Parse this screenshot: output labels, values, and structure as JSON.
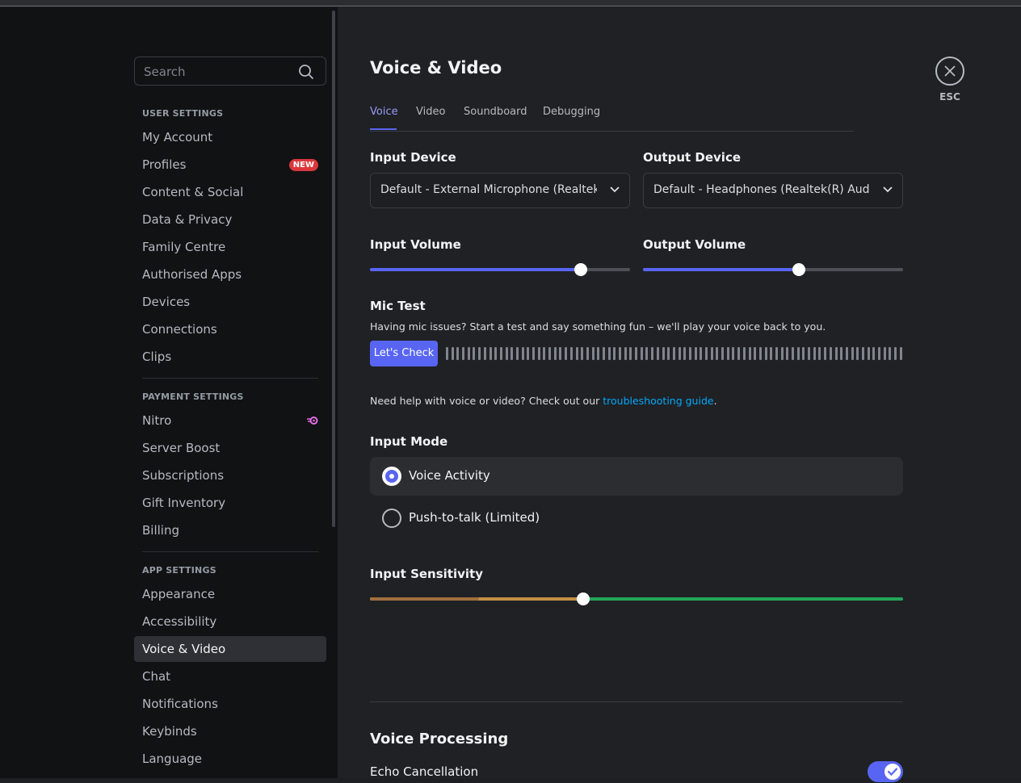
{
  "sidebar": {
    "search_placeholder": "Search",
    "sections": [
      {
        "header": "USER SETTINGS",
        "items": [
          "My Account",
          "Profiles",
          "Content & Social",
          "Data & Privacy",
          "Family Centre",
          "Authorised Apps",
          "Devices",
          "Connections",
          "Clips"
        ]
      },
      {
        "header": "PAYMENT SETTINGS",
        "items": [
          "Nitro",
          "Server Boost",
          "Subscriptions",
          "Gift Inventory",
          "Billing"
        ]
      },
      {
        "header": "APP SETTINGS",
        "items": [
          "Appearance",
          "Accessibility",
          "Voice & Video",
          "Chat",
          "Notifications",
          "Keybinds",
          "Language"
        ]
      }
    ],
    "new_badge": "NEW",
    "active_item": "Voice & Video"
  },
  "main": {
    "title": "Voice & Video",
    "tabs": [
      "Voice",
      "Video",
      "Soundboard",
      "Debugging"
    ],
    "active_tab": "Voice",
    "input_device": {
      "label": "Input Device",
      "value": "Default - External Microphone (Realtek(R) Audio)"
    },
    "output_device": {
      "label": "Output Device",
      "value": "Default - Headphones (Realtek(R) Audio)"
    },
    "input_volume": {
      "label": "Input Volume",
      "percent": 81
    },
    "output_volume": {
      "label": "Output Volume",
      "percent": 60
    },
    "mic_test": {
      "label": "Mic Test",
      "description": "Having mic issues? Start a test and say something fun – we'll play your voice back to you.",
      "button": "Let's Check"
    },
    "help": {
      "text": "Need help with voice or video? Check out our ",
      "link": "troubleshooting guide",
      "suffix": "."
    },
    "input_mode": {
      "label": "Input Mode",
      "options": [
        "Voice Activity",
        "Push-to-talk (Limited)"
      ],
      "selected": "Voice Activity"
    },
    "input_sensitivity": {
      "label": "Input Sensitivity",
      "percent": 40
    },
    "voice_processing": {
      "title": "Voice Processing",
      "echo_cancellation": "Echo Cancellation",
      "echo_enabled": true
    }
  },
  "close": {
    "label": "ESC"
  },
  "colors": {
    "accent": "#5865f2",
    "link": "#00a8fc",
    "danger": "#da373c",
    "success": "#23a559"
  }
}
